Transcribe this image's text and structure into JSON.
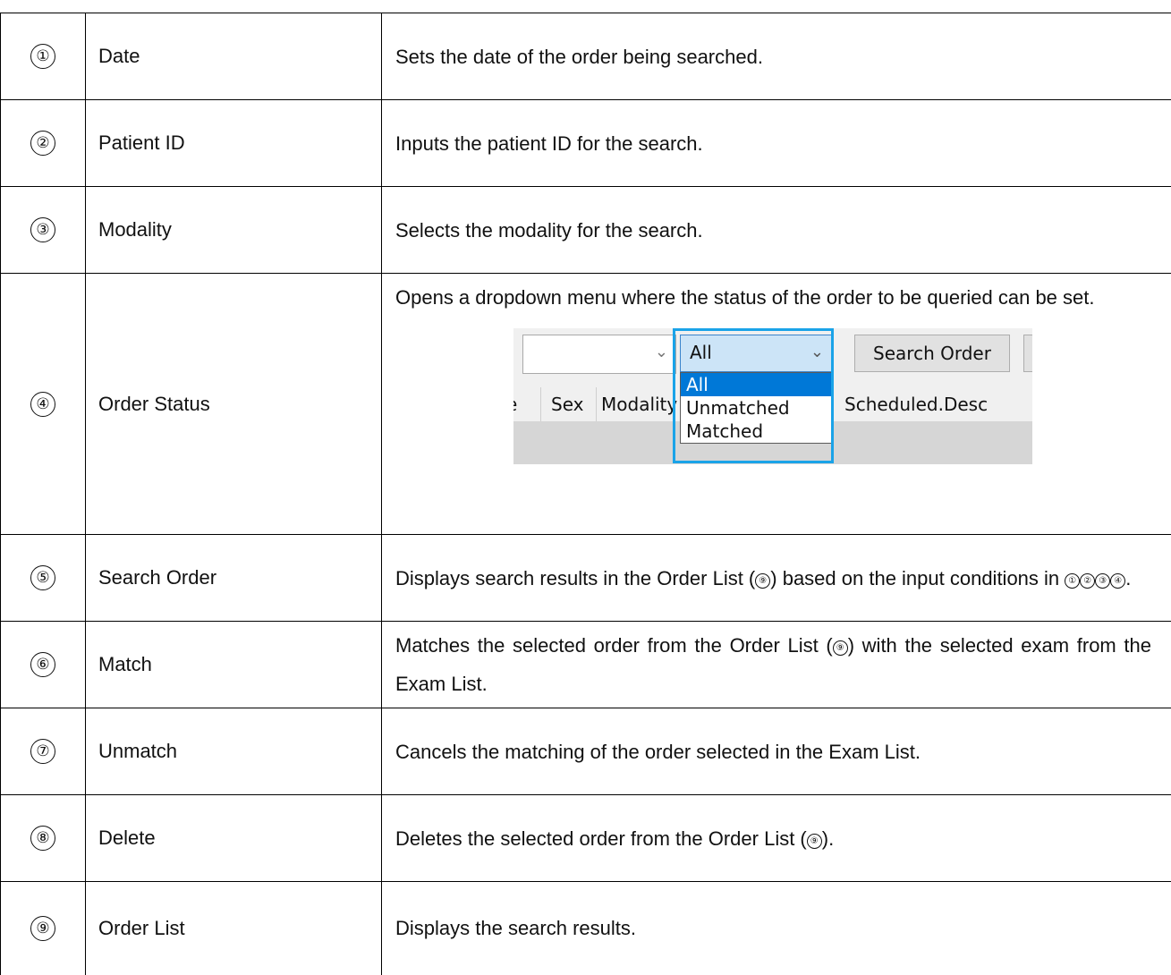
{
  "rows": [
    {
      "num": "①",
      "name": "Date",
      "desc": "Sets the date of the order being searched."
    },
    {
      "num": "②",
      "name": "Patient ID",
      "desc": "Inputs the patient ID for the search."
    },
    {
      "num": "③",
      "name": "Modality",
      "desc": "Selects the modality for the search."
    },
    {
      "num": "④",
      "name": "Order Status",
      "desc": "Opens a dropdown menu where the status of the order to be queried can be set."
    },
    {
      "num": "⑤",
      "name": "Search Order",
      "desc_prefix": "Displays search results in the Order List (",
      "desc_ref": "⑨",
      "desc_mid": ") based on the input conditions in ",
      "desc_refs": [
        "①",
        "②",
        "③",
        "④"
      ],
      "desc_end": "."
    },
    {
      "num": "⑥",
      "name": "Match",
      "desc_prefix": "Matches the selected order from the Order List (",
      "desc_ref": "⑨",
      "desc_end": ") with the selected exam from the Exam List."
    },
    {
      "num": "⑦",
      "name": "Unmatch",
      "desc": "Cancels the matching of the order selected in the Exam List."
    },
    {
      "num": "⑧",
      "name": "Delete",
      "desc_prefix": "Deletes the selected order from the Order List (",
      "desc_ref": "⑨",
      "desc_end": ")."
    },
    {
      "num": "⑨",
      "name": "Order List",
      "desc": "Displays the search results."
    }
  ],
  "screenshot": {
    "combo_selected": "All",
    "search_button": "Search Order",
    "headers": [
      "e",
      "Sex",
      "Modality",
      "Scheduled.Desc"
    ],
    "options": [
      "All",
      "Unmatched",
      "Matched"
    ],
    "accent_color": "#1aa3e8",
    "selected_color": "#0078d7"
  }
}
